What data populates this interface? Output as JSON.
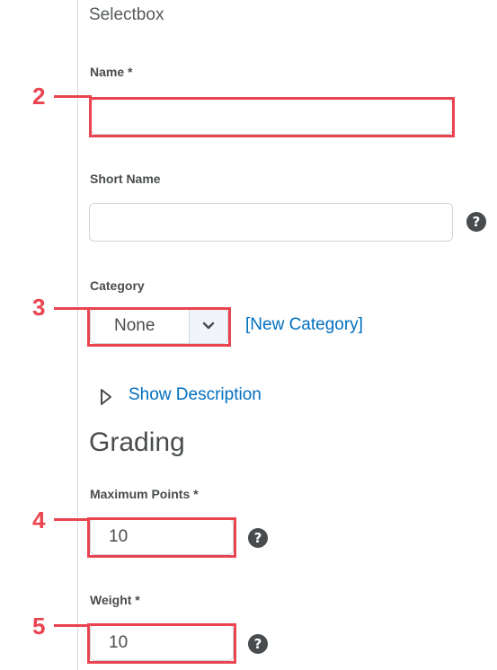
{
  "section": {
    "title": "Selectbox"
  },
  "fields": {
    "name": {
      "label": "Name *",
      "value": ""
    },
    "short_name": {
      "label": "Short Name",
      "value": ""
    },
    "category": {
      "label": "Category",
      "selected": "None",
      "new_link": "[New Category]"
    },
    "show_description": {
      "label": "Show Description"
    },
    "grading": {
      "heading": "Grading"
    },
    "max_points": {
      "label": "Maximum Points *",
      "value": "10"
    },
    "weight": {
      "label": "Weight *",
      "value": "10"
    }
  },
  "help_icon": "?",
  "annotations": [
    "2",
    "3",
    "4",
    "5"
  ],
  "colors": {
    "annotation": "#e9444f",
    "link": "#006fbf",
    "text": "#494c4e"
  },
  "icons": {
    "help": "question-circle-icon",
    "chevron": "chevron-down-icon",
    "expand": "triangle-right-icon"
  }
}
